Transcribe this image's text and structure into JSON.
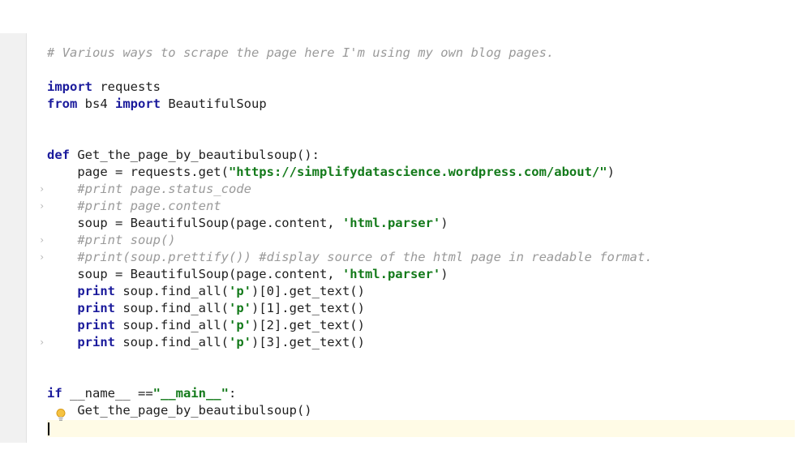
{
  "editor": {
    "lines": [
      {
        "parts": [
          {
            "t": "# Various ways to scrape the page here I'm using my own blog pages.",
            "c": "cmt"
          }
        ]
      },
      {
        "parts": []
      },
      {
        "parts": [
          {
            "t": "import",
            "c": "kw"
          },
          {
            "t": " requests",
            "c": ""
          }
        ]
      },
      {
        "parts": [
          {
            "t": "from",
            "c": "kw"
          },
          {
            "t": " bs4 ",
            "c": ""
          },
          {
            "t": "import",
            "c": "kw"
          },
          {
            "t": " BeautifulSoup",
            "c": ""
          }
        ]
      },
      {
        "parts": []
      },
      {
        "parts": []
      },
      {
        "parts": [
          {
            "t": "def",
            "c": "kw"
          },
          {
            "t": " Get_the_page_by_beautibulsoup():",
            "c": ""
          }
        ]
      },
      {
        "parts": [
          {
            "t": "    page = requests.get(",
            "c": ""
          },
          {
            "t": "\"https://simplifydatascience.wordpress.com/about/\"",
            "c": "str"
          },
          {
            "t": ")",
            "c": ""
          }
        ]
      },
      {
        "parts": [
          {
            "t": "    #print page.status_code",
            "c": "cmt"
          }
        ]
      },
      {
        "parts": [
          {
            "t": "    #print page.content",
            "c": "cmt"
          }
        ]
      },
      {
        "parts": [
          {
            "t": "    soup = BeautifulSoup(page.content, ",
            "c": ""
          },
          {
            "t": "'html.parser'",
            "c": "str"
          },
          {
            "t": ")",
            "c": ""
          }
        ]
      },
      {
        "parts": [
          {
            "t": "    #print soup()",
            "c": "cmt"
          }
        ]
      },
      {
        "parts": [
          {
            "t": "    #print(soup.prettify()) #display source of the html page in readable format.",
            "c": "cmt"
          }
        ]
      },
      {
        "parts": [
          {
            "t": "    soup = BeautifulSoup(page.content, ",
            "c": ""
          },
          {
            "t": "'html.parser'",
            "c": "str"
          },
          {
            "t": ")",
            "c": ""
          }
        ]
      },
      {
        "parts": [
          {
            "t": "    ",
            "c": ""
          },
          {
            "t": "print",
            "c": "kw"
          },
          {
            "t": " soup.find_all(",
            "c": ""
          },
          {
            "t": "'p'",
            "c": "str"
          },
          {
            "t": ")[0].get_text()",
            "c": ""
          }
        ]
      },
      {
        "parts": [
          {
            "t": "    ",
            "c": ""
          },
          {
            "t": "print",
            "c": "kw"
          },
          {
            "t": " soup.find_all(",
            "c": ""
          },
          {
            "t": "'p'",
            "c": "str"
          },
          {
            "t": ")[1].get_text()",
            "c": ""
          }
        ]
      },
      {
        "parts": [
          {
            "t": "    ",
            "c": ""
          },
          {
            "t": "print",
            "c": "kw"
          },
          {
            "t": " soup.find_all(",
            "c": ""
          },
          {
            "t": "'p'",
            "c": "str"
          },
          {
            "t": ")[2].get_text()",
            "c": ""
          }
        ]
      },
      {
        "parts": [
          {
            "t": "    ",
            "c": ""
          },
          {
            "t": "print",
            "c": "kw"
          },
          {
            "t": " soup.find_all(",
            "c": ""
          },
          {
            "t": "'p'",
            "c": "str"
          },
          {
            "t": ")[3].get_text()",
            "c": ""
          }
        ]
      },
      {
        "parts": []
      },
      {
        "parts": []
      },
      {
        "parts": [
          {
            "t": "if",
            "c": "kw"
          },
          {
            "t": " __name__ ==",
            "c": ""
          },
          {
            "t": "\"__main__\"",
            "c": "str"
          },
          {
            "t": ":",
            "c": ""
          }
        ]
      },
      {
        "parts": [
          {
            "t": "    Get_the_page_by_beautibulsoup()",
            "c": ""
          }
        ]
      },
      {
        "parts": []
      }
    ],
    "fold_marker_lines": [
      8,
      9,
      11,
      12,
      17
    ],
    "fold_marker_glyph": "›",
    "colors": {
      "keyword": "#1b1b9c",
      "string": "#137a1a",
      "comment": "#9a9a9a",
      "text": "#1f1f1f",
      "current_line": "#fffbe6",
      "gutter": "#f1f1f1"
    },
    "icons": {
      "intention": "lightbulb-icon"
    }
  }
}
